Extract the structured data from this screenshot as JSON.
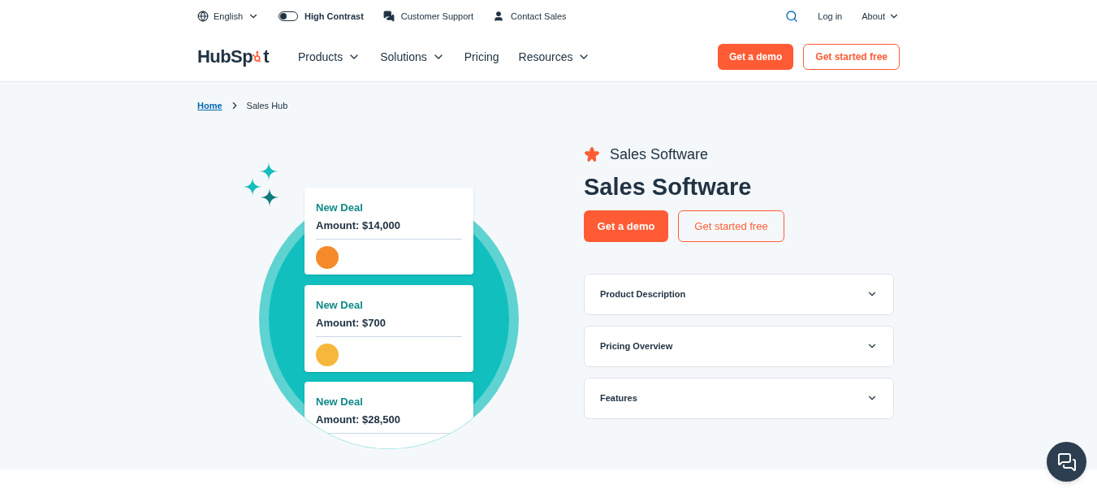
{
  "utility_bar": {
    "language": "English",
    "high_contrast": {
      "label": "High Contrast",
      "on": false
    },
    "links": [
      "Customer Support",
      "Contact Sales"
    ],
    "login": "Log in",
    "about": "About"
  },
  "nav": {
    "logo": {
      "before": "HubSp",
      "after": "t"
    },
    "items": [
      {
        "label": "Products",
        "dropdown": true
      },
      {
        "label": "Solutions",
        "dropdown": true
      },
      {
        "label": "Pricing",
        "dropdown": false
      },
      {
        "label": "Resources",
        "dropdown": true
      }
    ],
    "demo_button": "Get a demo",
    "free_button": "Get started free"
  },
  "breadcrumb": {
    "home": "Home",
    "current": "Sales Hub"
  },
  "illustration": {
    "deals": [
      {
        "title": "New Deal",
        "amount": "Amount: $14,000",
        "color": "#f58a2a"
      },
      {
        "title": "New Deal",
        "amount": "Amount: $700",
        "color": "#f6b73c"
      },
      {
        "title": "New Deal",
        "amount": "Amount: $28,500"
      }
    ]
  },
  "hero": {
    "eyebrow": "Sales Software",
    "title": "Sales Software",
    "demo_button": "Get a demo",
    "free_button": "Get started free",
    "accordions": [
      {
        "label": "Product Description",
        "expanded": false
      },
      {
        "label": "Pricing Overview",
        "expanded": false
      },
      {
        "label": "Features",
        "expanded": false
      }
    ]
  }
}
